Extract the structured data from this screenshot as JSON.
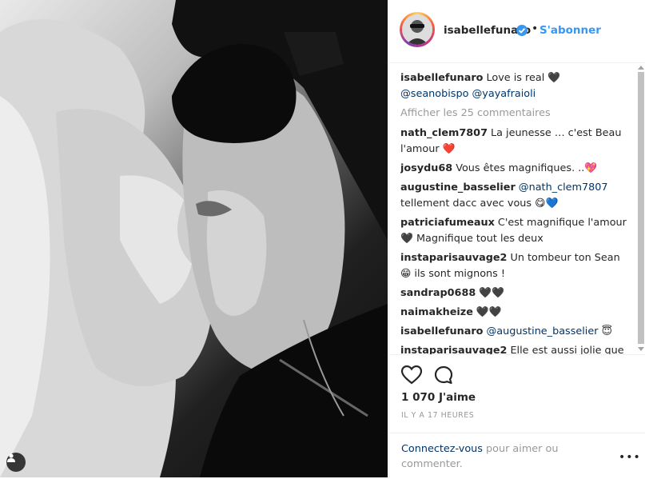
{
  "post": {
    "author": "isabellefunaro",
    "follow_label": "S'abonner",
    "dot": "•",
    "caption_user": "isabellefunaro",
    "caption_text": "Love is real 🖤",
    "caption_mentions": "@seanobispo @yayafraioli",
    "more_comments": "Afficher les 25 commentaires",
    "likes": "1 070 J'aime",
    "time": "IL Y A 17 HEURES",
    "login_link": "Connectez-vous",
    "login_text": " pour aimer ou commenter.",
    "options": "•••"
  },
  "comments": [
    {
      "user": "nath_clem7807",
      "text": "La jeunesse … c'est Beau l'amour ❤️"
    },
    {
      "user": "josydu68",
      "text": "Vous êtes magnifiques. ..💖"
    },
    {
      "user": "augustine_basselier",
      "mention": "@nath_clem7807",
      "text": " tellement dacc avec vous 😋💙"
    },
    {
      "user": "patriciafumeaux",
      "text": "C'est magnifique l'amour 🖤 Magnifique tout les deux"
    },
    {
      "user": "instaparisauvage2",
      "text": "Un tombeur ton Sean 😁 ils sont mignons !"
    },
    {
      "user": "sandrap0688",
      "text": "🖤🖤"
    },
    {
      "user": "naimakheize",
      "text": "🖤🖤"
    },
    {
      "user": "isabellefunaro",
      "mention": "@augustine_basselier",
      "text": " 😇"
    },
    {
      "user": "instaparisauvage2",
      "text": "Elle est aussi jolie que sa"
    }
  ],
  "icons": {
    "heart": "heart-icon",
    "comment": "comment-icon",
    "verified": "verified-badge-icon",
    "tag": "user-tag-icon"
  },
  "colors": {
    "link": "#3897f0",
    "mention": "#003569",
    "muted": "#999999"
  }
}
